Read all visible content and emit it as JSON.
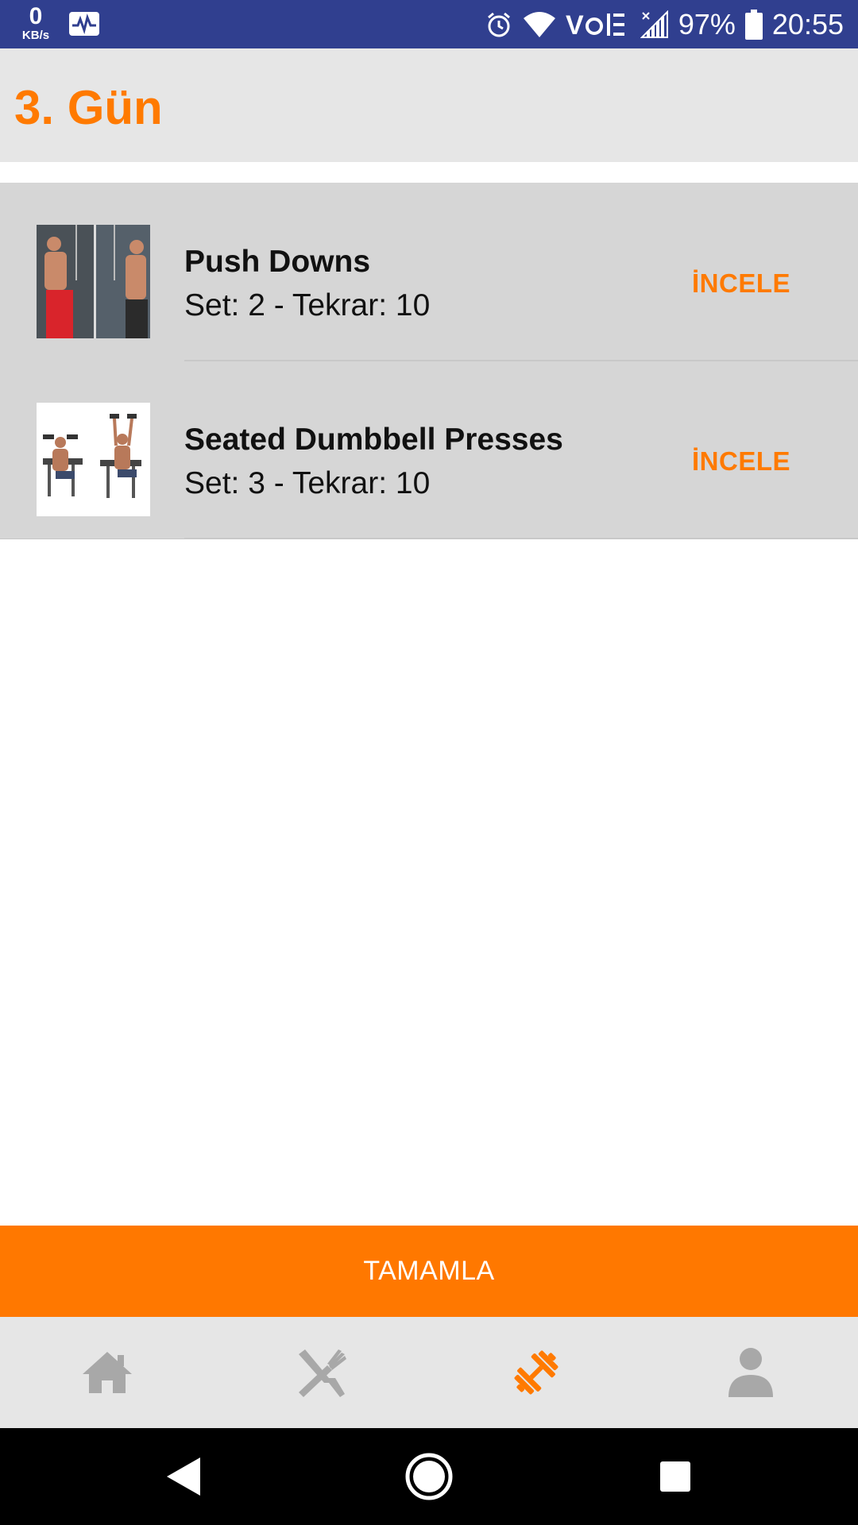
{
  "status_bar": {
    "net_speed_value": "0",
    "net_speed_unit": "KB/s",
    "battery": "97%",
    "time": "20:55",
    "icons": [
      "activity-icon",
      "alarm-icon",
      "wifi-icon",
      "volte-icon",
      "signal-icon",
      "battery-icon"
    ]
  },
  "header": {
    "title": "3. Gün"
  },
  "exercises": [
    {
      "name": "Push Downs",
      "detail": "Set: 2 - Tekrar: 10",
      "action": "İNCELE"
    },
    {
      "name": "Seated Dumbbell Presses",
      "detail": "Set: 3 - Tekrar: 10",
      "action": "İNCELE"
    }
  ],
  "complete_button": {
    "label": "TAMAMLA"
  },
  "bottom_nav": {
    "items": [
      {
        "icon": "home-icon",
        "active": false
      },
      {
        "icon": "utensils-icon",
        "active": false
      },
      {
        "icon": "dumbbell-icon",
        "active": true
      },
      {
        "icon": "person-icon",
        "active": false
      }
    ]
  },
  "colors": {
    "accent": "#FF7A00",
    "status_bar": "#303F8F",
    "header_bg": "#E6E6E6",
    "list_bg": "#D6D6D6",
    "inactive_icon": "#A8A8A8"
  }
}
